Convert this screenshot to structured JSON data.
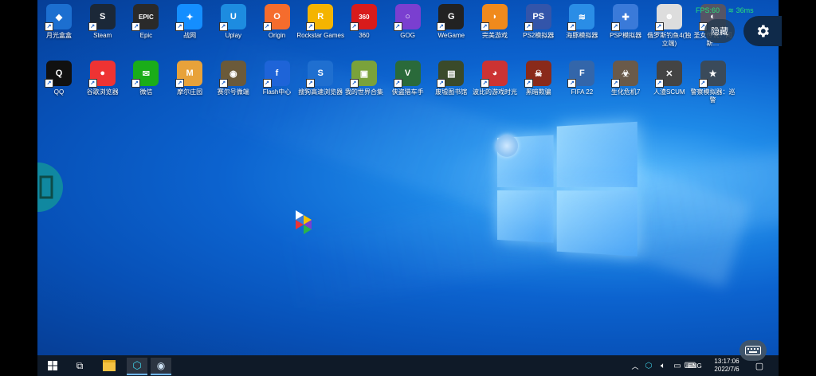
{
  "desktop_icons_row1": [
    {
      "label": "月光盒盒",
      "color": "#1c6fd0",
      "glyph": "◆"
    },
    {
      "label": "Steam",
      "color": "#1b2838",
      "glyph": "S"
    },
    {
      "label": "Epic",
      "color": "#2a2a2a",
      "glyph": "EPIC"
    },
    {
      "label": "战网",
      "color": "#148eff",
      "glyph": "✦"
    },
    {
      "label": "Uplay",
      "color": "#1d8ce0",
      "glyph": "U"
    },
    {
      "label": "Origin",
      "color": "#f56c2d",
      "glyph": "O"
    },
    {
      "label": "Rockstar Games",
      "color": "#f4b400",
      "glyph": "R"
    },
    {
      "label": "360",
      "color": "#d81b1b",
      "glyph": "360"
    },
    {
      "label": "GOG",
      "color": "#7a3fd0",
      "glyph": "○"
    },
    {
      "label": "WeGame",
      "color": "#222",
      "glyph": "G"
    },
    {
      "label": "完美游戏",
      "color": "#f08a1c",
      "glyph": "◗"
    },
    {
      "label": "PS2模拟器",
      "color": "#3355aa",
      "glyph": "PS"
    },
    {
      "label": "海豚模拟器",
      "color": "#2a8de6",
      "glyph": "≋"
    },
    {
      "label": "PSP模拟器",
      "color": "#3a7ad9",
      "glyph": "✚"
    },
    {
      "label": "俄罗斯钓鱼4(独立端)",
      "color": "#ddd",
      "glyph": "☻"
    },
    {
      "label": "圣女传说：阿斯…",
      "color": "#556",
      "glyph": "◐"
    }
  ],
  "desktop_icons_row2": [
    {
      "label": "QQ",
      "color": "#111",
      "glyph": "Q"
    },
    {
      "label": "谷歌浏览器",
      "color": "#e33",
      "glyph": "●"
    },
    {
      "label": "微信",
      "color": "#1aad19",
      "glyph": "✉"
    },
    {
      "label": "摩尔庄园",
      "color": "#e8a23a",
      "glyph": "M"
    },
    {
      "label": "赛尔号微端",
      "color": "#6b5a3a",
      "glyph": "◉"
    },
    {
      "label": "Flash中心",
      "color": "#1e64d8",
      "glyph": "f"
    },
    {
      "label": "搜狗高速浏览器",
      "color": "#1f6fd0",
      "glyph": "S"
    },
    {
      "label": "我的世界合集",
      "color": "#7aa23b",
      "glyph": "▣"
    },
    {
      "label": "侠盗猎车手",
      "color": "#2a6a3a",
      "glyph": "V"
    },
    {
      "label": "废墟图书馆",
      "color": "#3a4a2a",
      "glyph": "▤"
    },
    {
      "label": "波比的游戏时光",
      "color": "#c33",
      "glyph": "◕"
    },
    {
      "label": "黑暗欺骗",
      "color": "#8a2a1a",
      "glyph": "☠"
    },
    {
      "label": "FIFA 22",
      "color": "#3366aa",
      "glyph": "F"
    },
    {
      "label": "生化危机7",
      "color": "#6a5a4a",
      "glyph": "☣"
    },
    {
      "label": "人渣SCUM",
      "color": "#444",
      "glyph": "✕"
    },
    {
      "label": "警察模拟器：巡警",
      "color": "#3a4a5a",
      "glyph": "★"
    }
  ],
  "overlay": {
    "ping": "36ms",
    "fps": "FPS:60",
    "hide_label": "隐藏"
  },
  "taskbar": {
    "language": "ENG",
    "time": "13:17:06",
    "date": "2022/7/6"
  }
}
